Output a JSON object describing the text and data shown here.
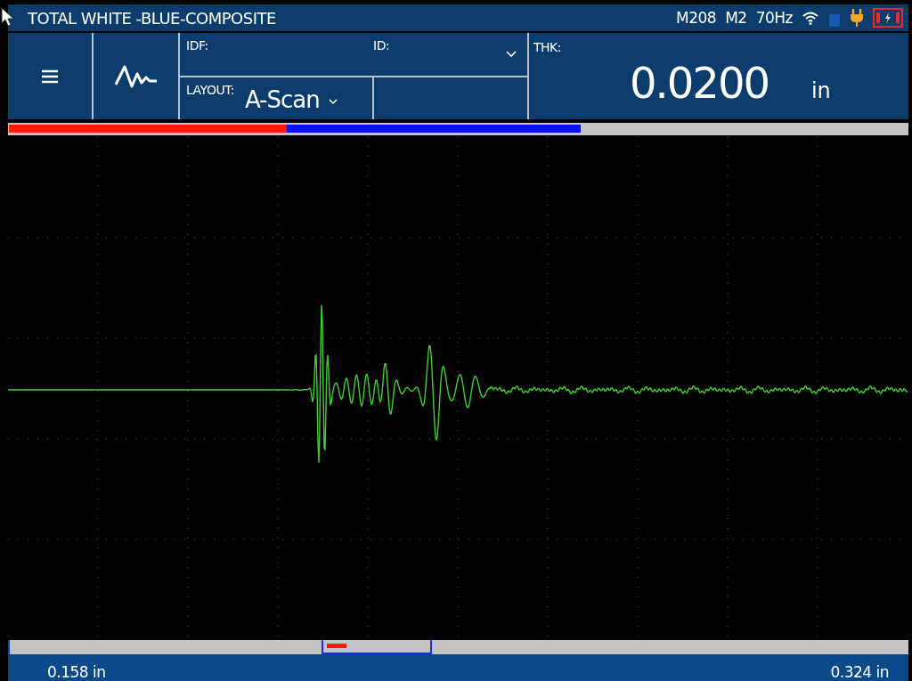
{
  "window": {
    "title": "TOTAL WHITE -BLUE-COMPOSITE"
  },
  "status": [
    "M208",
    "M2",
    "70Hz"
  ],
  "header": {
    "idf_label": "IDF:",
    "id_label": "ID:",
    "layout_label": "LAYOUT:",
    "layout_value": "A-Scan",
    "thk_label": "THK:",
    "thk_value": "0.0200",
    "thk_unit": "in"
  },
  "footer": {
    "range_start": "0.158 in",
    "range_end": "0.324 in"
  }
}
